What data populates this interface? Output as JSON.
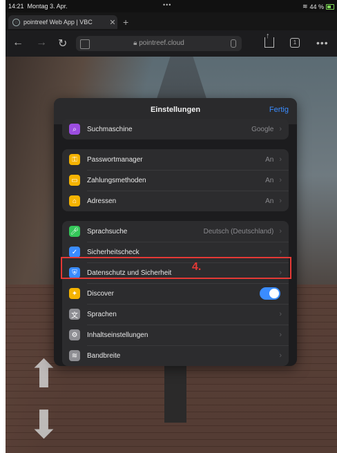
{
  "status": {
    "time": "14:21",
    "date": "Montag 3. Apr.",
    "dots": "•••",
    "battery": "44 %"
  },
  "tab": {
    "title": "pointreef Web App | VBC",
    "close": "✕",
    "new": "+"
  },
  "address": {
    "url": "pointreef.cloud",
    "back": "←",
    "forward": "→",
    "reload": "↻",
    "tabs_count": "1",
    "more": "•••"
  },
  "panel": {
    "title": "Einstellungen",
    "done": "Fertig",
    "groups": [
      {
        "rows": [
          {
            "label": "Suchmaschine",
            "value": "Google",
            "icon": "search-icon",
            "color": "#9b4de0"
          }
        ]
      },
      {
        "rows": [
          {
            "label": "Passwortmanager",
            "value": "An",
            "icon": "key-icon",
            "color": "#f5b301"
          },
          {
            "label": "Zahlungsmethoden",
            "value": "An",
            "icon": "card-icon",
            "color": "#f5b301"
          },
          {
            "label": "Adressen",
            "value": "An",
            "icon": "address-icon",
            "color": "#f5b301"
          }
        ]
      },
      {
        "rows": [
          {
            "label": "Sprachsuche",
            "value": "Deutsch (Deutschland)",
            "icon": "mic-icon",
            "color": "#34c759"
          },
          {
            "label": "Sicherheitscheck",
            "value": "",
            "icon": "shield-check-icon",
            "color": "#3a8cff"
          },
          {
            "label": "Datenschutz und Sicherheit",
            "value": "",
            "icon": "privacy-icon",
            "color": "#3a8cff"
          },
          {
            "label": "Discover",
            "value": "",
            "icon": "discover-icon",
            "color": "#f5b301",
            "toggle": true
          },
          {
            "label": "Sprachen",
            "value": "",
            "icon": "translate-icon",
            "color": "#8e8e93"
          },
          {
            "label": "Inhaltseinstellungen",
            "value": "",
            "icon": "gear-icon",
            "color": "#8e8e93"
          },
          {
            "label": "Bandbreite",
            "value": "",
            "icon": "wifi-icon",
            "color": "#8e8e93"
          }
        ]
      }
    ]
  },
  "annotation": {
    "step": "4."
  }
}
